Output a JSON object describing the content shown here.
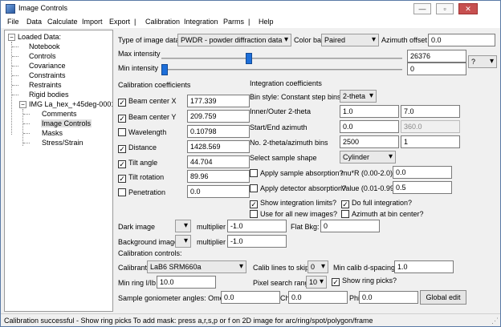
{
  "window": {
    "title": "Image Controls"
  },
  "menu": [
    "File",
    "Data",
    "Calculate",
    "Import",
    "Export",
    "|",
    "Calibration",
    "Integration",
    "Parms",
    "|",
    "Help"
  ],
  "tree": {
    "root": "Loaded Data:",
    "items": [
      "Notebook",
      "Controls",
      "Covariance",
      "Constraints",
      "Restraints",
      "Rigid bodies"
    ],
    "img_node": "IMG La_hex_+45deg-00015.tif",
    "img_children": [
      "Comments",
      "Image Controls",
      "Masks",
      "Stress/Strain"
    ]
  },
  "top": {
    "type_label": "Type of image data:",
    "type_value": "PWDR - powder diffraction data",
    "colorbar_label": "Color bar",
    "colorbar_value": "Paired",
    "azoffset_label": "Azimuth offset",
    "azoffset_value": "0.0",
    "maxint_label": "Max intensity",
    "maxint_value": "26376",
    "maxint_fraction": 0.36,
    "minint_label": "Min intensity",
    "minint_value": "0",
    "minint_fraction": 0.0,
    "help_combo": "?"
  },
  "calib": {
    "header": "Calibration coefficients",
    "rows": [
      {
        "label": "Beam center X",
        "value": "177.339",
        "checked": true
      },
      {
        "label": "Beam center Y",
        "value": "209.759",
        "checked": true
      },
      {
        "label": "Wavelength",
        "value": "0.10798",
        "checked": false
      },
      {
        "label": "Distance",
        "value": "1428.569",
        "checked": true
      },
      {
        "label": "Tilt angle",
        "value": "44.704",
        "checked": true
      },
      {
        "label": "Tilt rotation",
        "value": "89.96",
        "checked": true
      },
      {
        "label": "Penetration",
        "value": "0.0",
        "checked": false
      }
    ]
  },
  "integ": {
    "header": "Integration coefficients",
    "binstyle_label": "Bin style: Constant step bins in",
    "binstyle_value": "2-theta",
    "inout_label": "Inner/Outer 2-theta",
    "inner": "1.0",
    "outer": "7.0",
    "azim_label": "Start/End azimuth",
    "az_start": "0.0",
    "az_end": "360.0",
    "bins_label": "No. 2-theta/azimuth bins",
    "bins_2t": "2500",
    "bins_az": "1",
    "shape_label": "Select sample shape",
    "shape_value": "Cylinder",
    "abs_label": "Apply sample absorption?",
    "mur_label": "mu*R (0.00-2.0)",
    "mur_value": "0.0",
    "det_label": "Apply detector absorption?",
    "val_label": "Value (0.01-0.99)",
    "val_value": "0.5",
    "showlim_label": "Show integration limits?",
    "fullint_label": "Do full integration?",
    "usenew_label": "Use for all new images?",
    "azbin_label": "Azimuth at bin center?"
  },
  "dark": {
    "dark_label": "Dark image",
    "mult_label": "multiplier",
    "dark_mult": "-1.0",
    "flat_label": "Flat Bkg:",
    "flat_value": "0",
    "bg_label": "Background image",
    "bg_mult": "-1.0"
  },
  "calctrl": {
    "header": "Calibration controls:",
    "calibrant_label": "Calibrant",
    "calibrant_value": "LaB6  SRM660a",
    "skip_label": "Calib lines to skip",
    "skip_value": "0",
    "mind_label": "Min calib d-spacing",
    "mind_value": "1.0",
    "minring_label": "Min ring I/Ib",
    "minring_value": "10.0",
    "pixsearch_label": "Pixel search range",
    "pixsearch_value": "10",
    "showpicks_label": "Show ring picks?"
  },
  "gonio": {
    "label": "Sample goniometer angles: Omega",
    "omega": "0.0",
    "chi_label": "Chi",
    "chi": "0.0",
    "phi_label": "Phi",
    "phi": "0.0",
    "global_btn": "Global edit"
  },
  "status": "Calibration successful - Show ring picks To add mask: press a,r,s,p or f on 2D image for arc/ring/spot/polygon/frame"
}
